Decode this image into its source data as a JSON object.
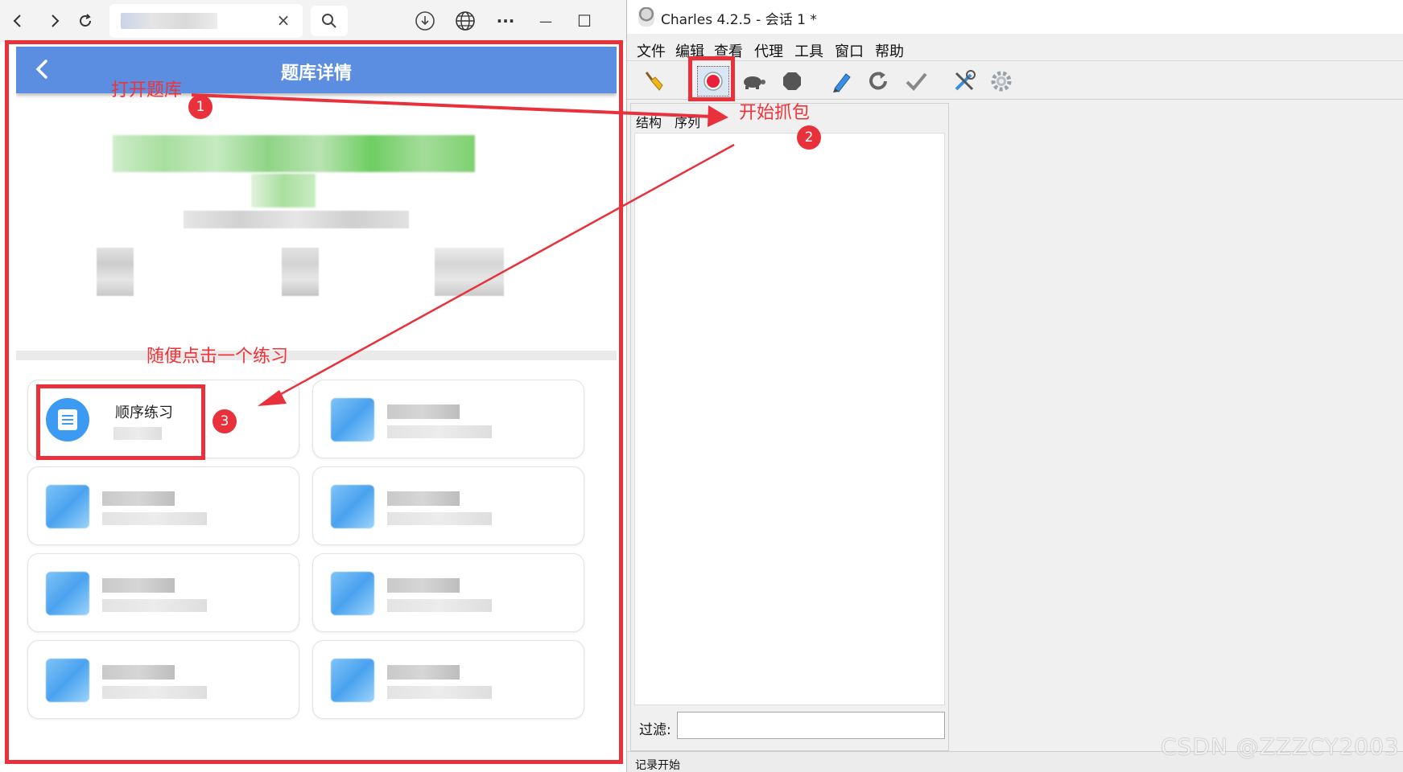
{
  "browser": {
    "back_icon": "chevron-left-icon",
    "forward_icon": "chevron-right-icon",
    "reload_icon": "reload-icon",
    "tab_close": "×",
    "search_icon": "search-icon",
    "download_icon": "download-icon",
    "globe_icon": "globe-icon",
    "more_label": "···",
    "minimize_label": "—",
    "maximize_label": "☐"
  },
  "app": {
    "header_title": "题库详情",
    "back_label": "‹",
    "cards": [
      {
        "label": "顺序练习"
      }
    ]
  },
  "annotations": {
    "open_bank": "打开题库",
    "start_capture": "开始抓包",
    "click_practice": "随便点击一个练习",
    "badge_1": "1",
    "badge_2": "2",
    "badge_3": "3",
    "color": "#e8313a"
  },
  "charles": {
    "title": "Charles 4.2.5 - 会话 1 *",
    "menu": [
      "文件",
      "编辑",
      "查看",
      "代理",
      "工具",
      "窗口",
      "帮助"
    ],
    "tabs": [
      "结构",
      "序列"
    ],
    "filter_label": "过滤:",
    "filter_value": "",
    "status_text": "记录开始"
  },
  "watermark": "CSDN @ZZZCY2003",
  "colors": {
    "app_header": "#5b8de1",
    "record_red": "#e8203a",
    "accent_blue": "#3d9af2"
  }
}
